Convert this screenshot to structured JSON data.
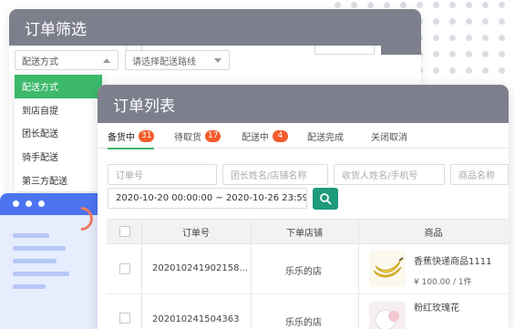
{
  "filter_panel": {
    "title": "订单筛选",
    "delivery_select": "配送方式",
    "route_select_placeholder": "请选择配送路线",
    "delivery_options": [
      "配送方式",
      "到店自提",
      "团长配送",
      "骑手配送",
      "第三方配送"
    ],
    "selected_option_index": 0
  },
  "order_panel": {
    "title": "订单列表",
    "tabs": [
      {
        "label": "备货中",
        "badge": "31"
      },
      {
        "label": "待取货",
        "badge": "17"
      },
      {
        "label": "配送中",
        "badge": "4"
      },
      {
        "label": "配送完成",
        "badge": ""
      },
      {
        "label": "关闭取消",
        "badge": ""
      }
    ],
    "active_tab_index": 0,
    "filters": {
      "order_no_placeholder": "订单号",
      "leader_placeholder": "团长姓名/店铺名称",
      "receiver_placeholder": "收货人姓名/手机号",
      "product_placeholder": "商品名称",
      "date_range": "2020-10-20 00:00:00 ~ 2020-10-26 23:59:59"
    },
    "table": {
      "columns": [
        "订单号",
        "下单店铺",
        "商品"
      ],
      "rows": [
        {
          "order_no": "202010241902158...",
          "shop": "乐乐的店",
          "product_name": "香蕉快递商品1111",
          "price": "¥ 100.00 / 1件"
        },
        {
          "order_no": "202010241504363",
          "shop": "乐乐的店",
          "product_name": "粉红玫瑰花",
          "price": ""
        }
      ]
    }
  },
  "colors": {
    "header_gray": "#7d7f8c",
    "accent_green": "#3cb96a",
    "badge_red": "#f25b2a",
    "search_button": "#1e9a7c",
    "decor_blue": "#4c74f0"
  }
}
